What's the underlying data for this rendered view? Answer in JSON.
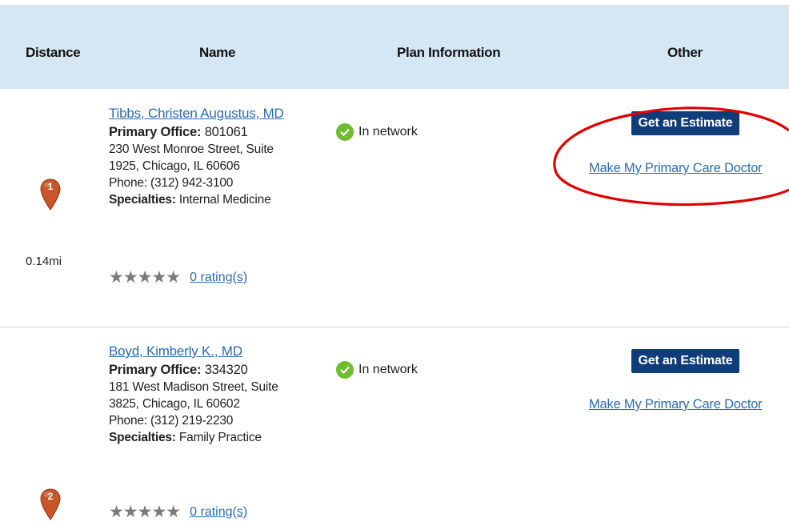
{
  "header": {
    "distance": "Distance",
    "name": "Name",
    "plan": "Plan Information",
    "other": "Other"
  },
  "results": [
    {
      "marker": "1",
      "marker_color": "#c9552b",
      "distance": "0.14mi",
      "name": "Tibbs, Christen Augustus, MD",
      "office_label": "Primary Office:",
      "office_id": "801061",
      "address_1": "230 West Monroe Street, Suite",
      "address_2": "1925, Chicago, IL 60606",
      "phone": "Phone: (312) 942-3100",
      "specialties_label": "Specialties:",
      "specialties": "Internal Medicine",
      "stars": "★★★★★",
      "ratings": "0 rating(s)",
      "network": "In network",
      "estimate_label": "Get an Estimate",
      "pcp_label": "Make My Primary Care Doctor"
    },
    {
      "marker": "2",
      "marker_color": "#c9552b",
      "distance": "",
      "name": "Boyd, Kimberly K., MD",
      "office_label": "Primary Office:",
      "office_id": "334320",
      "address_1": "181 West Madison Street, Suite",
      "address_2": "3825, Chicago, IL 60602",
      "phone": "Phone: (312) 219-2230",
      "specialties_label": "Specialties:",
      "specialties": "Family Practice",
      "stars": "★★★★★",
      "ratings": "0 rating(s)",
      "network": "In network",
      "estimate_label": "Get an Estimate",
      "pcp_label": "Make My Primary Care Doctor"
    }
  ],
  "icons": {
    "check": "check-circle-icon",
    "marker": "map-marker-icon",
    "star": "star-icon"
  },
  "colors": {
    "header_bg": "#d6e7f4",
    "link": "#2a6cb0",
    "button_bg": "#0e3d79",
    "annotation": "#e00000",
    "check": "#6ebd2e"
  }
}
